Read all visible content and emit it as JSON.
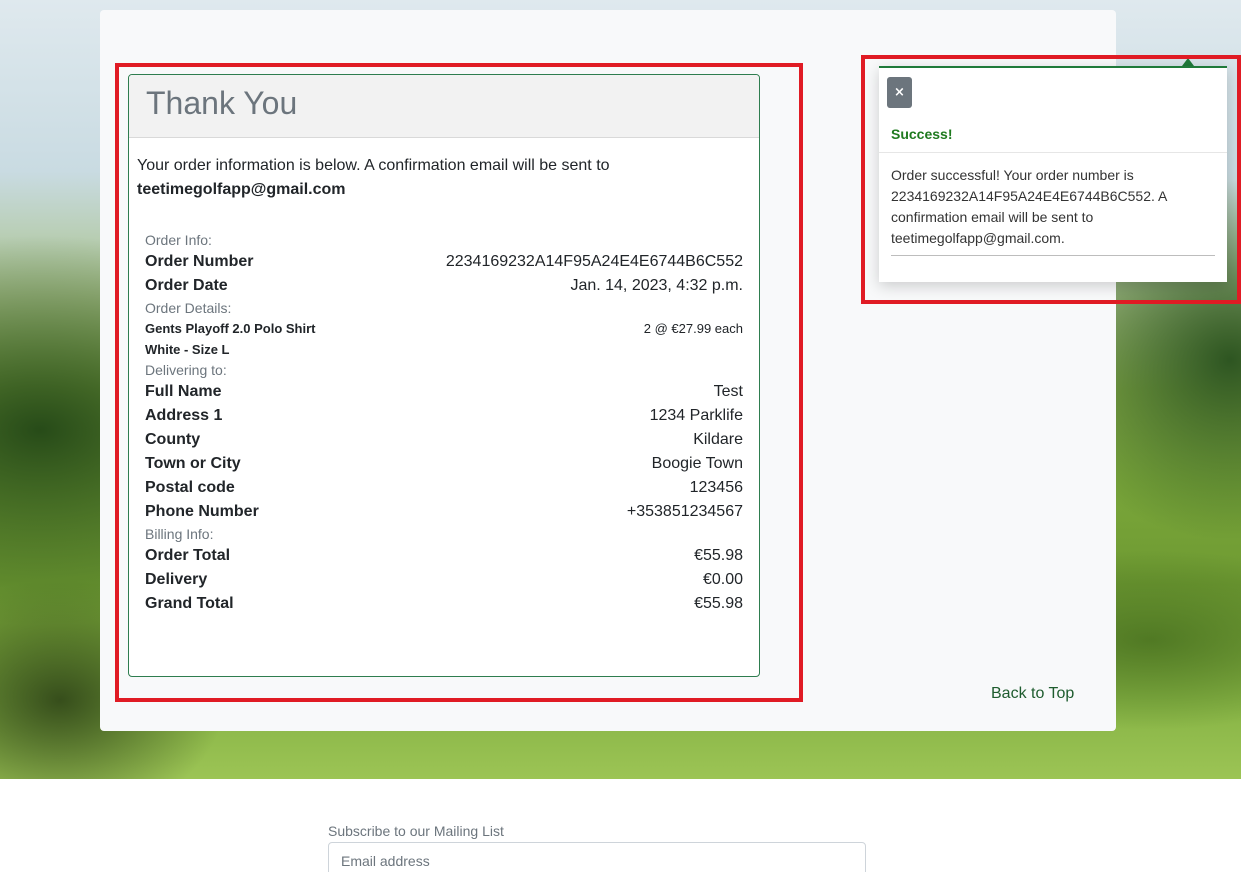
{
  "order": {
    "title": "Thank You",
    "intro": "Your order information is below. A confirmation email will be sent to",
    "email": "teetimegolfapp@gmail.com",
    "order_info_label": "Order Info:",
    "order_number_label": "Order Number",
    "order_number": "2234169232A14F95A24E4E6744B6C552",
    "order_date_label": "Order Date",
    "order_date": "Jan. 14, 2023, 4:32 p.m.",
    "order_details_label": "Order Details:",
    "product_name": "Gents Playoff 2.0 Polo Shirt",
    "product_variant": "White - Size L",
    "product_qty_price": "2 @ €27.99 each",
    "delivering_label": "Delivering to:",
    "full_name_label": "Full Name",
    "full_name": "Test",
    "address1_label": "Address 1",
    "address1": "1234 Parklife",
    "county_label": "County",
    "county": "Kildare",
    "town_label": "Town or City",
    "town": "Boogie Town",
    "postcode_label": "Postal code",
    "postcode": "123456",
    "phone_label": "Phone Number",
    "phone": "+353851234567",
    "billing_label": "Billing Info:",
    "order_total_label": "Order Total",
    "order_total": "€55.98",
    "delivery_label": "Delivery",
    "delivery": "€0.00",
    "grand_total_label": "Grand Total",
    "grand_total": "€55.98"
  },
  "nav": {
    "back_to_top": "Back to Top"
  },
  "toast": {
    "close_label": "×",
    "title": "Success!",
    "message": "Order successful! Your order number is 2234169232A14F95A24E4E6744B6C552. A confirmation email will be sent to teetimegolfapp@gmail.com."
  },
  "footer": {
    "mailing_label": "Subscribe to our Mailing List",
    "email_placeholder": "Email address"
  },
  "colors": {
    "highlight": "#e01b24",
    "success_green": "#1f7a1f",
    "link_green": "#1e5c2e"
  }
}
